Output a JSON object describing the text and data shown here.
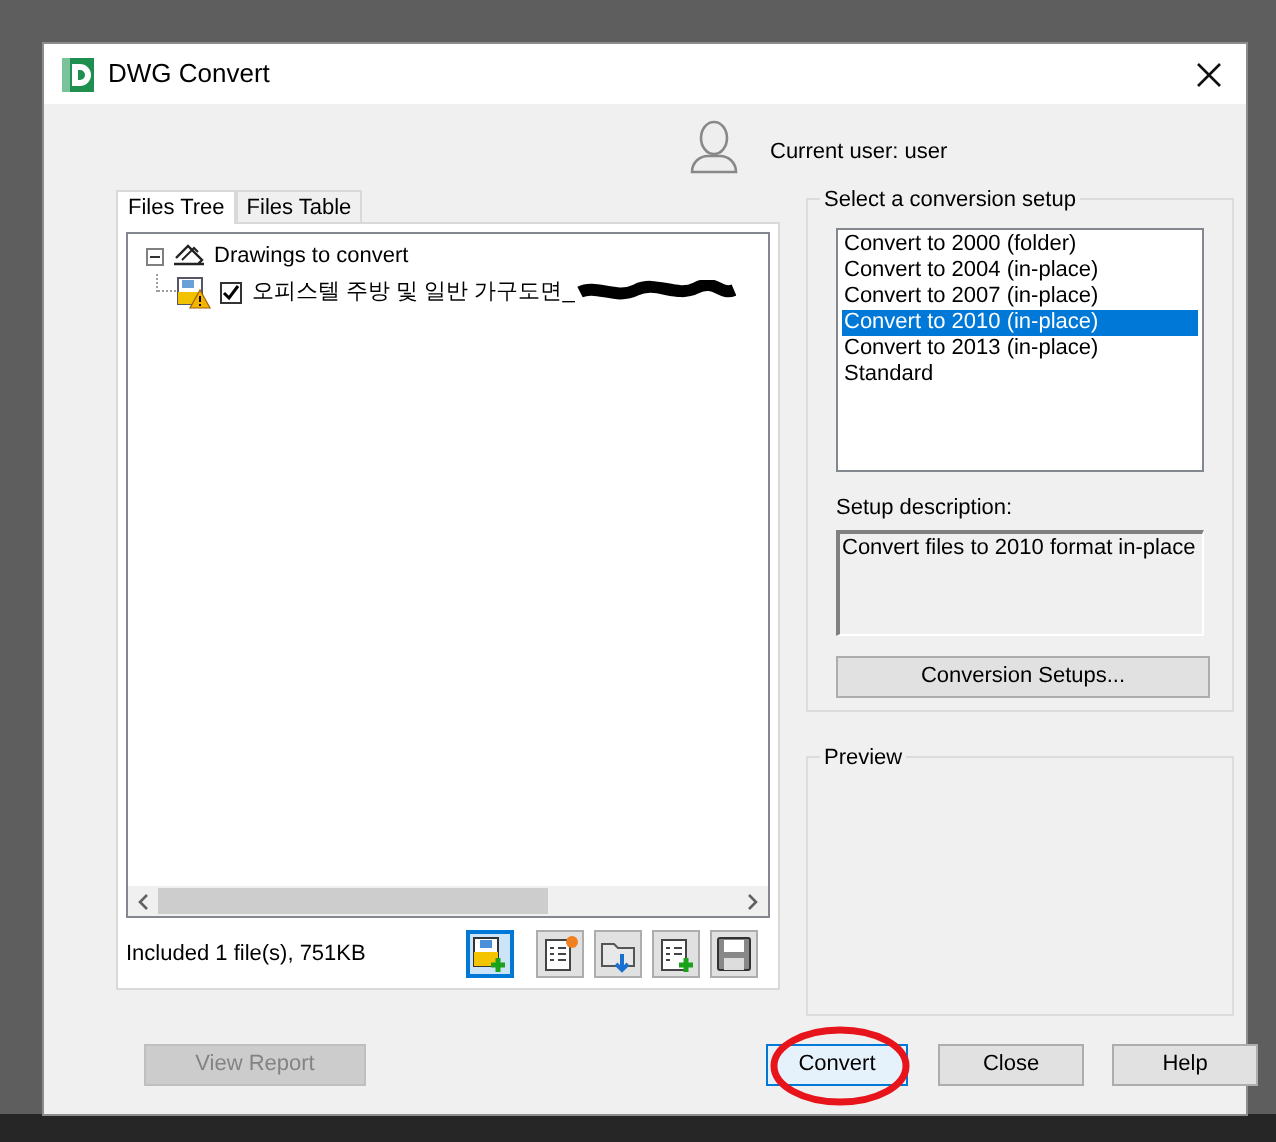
{
  "window": {
    "title": "DWG Convert"
  },
  "current_user": "Current user: user",
  "tabs": [
    {
      "label": "Files Tree",
      "selected": true
    },
    {
      "label": "Files Table",
      "selected": false
    }
  ],
  "tree": {
    "label": "Drawings to convert",
    "expanded": true,
    "children": [
      {
        "label": "오피스텔 주방 및 일반 가구도면_",
        "checked": true,
        "redacted": true
      }
    ]
  },
  "status": "Included 1 file(s), 751KB",
  "toolbar": [
    {
      "kind": "add-file",
      "selected": true
    },
    {
      "kind": "new-list",
      "selected": false
    },
    {
      "kind": "open-folder",
      "selected": false
    },
    {
      "kind": "append-list",
      "selected": false
    },
    {
      "kind": "save",
      "selected": false
    }
  ],
  "setup_group": {
    "title": "Select a conversion setup",
    "items": [
      {
        "label": "Convert to 2000 (folder)",
        "selected": false
      },
      {
        "label": "Convert to 2004 (in-place)",
        "selected": false
      },
      {
        "label": "Convert to 2007 (in-place)",
        "selected": false
      },
      {
        "label": "Convert to 2010 (in-place)",
        "selected": true
      },
      {
        "label": "Convert to 2013 (in-place)",
        "selected": false
      },
      {
        "label": "Standard",
        "selected": false
      }
    ],
    "description_label": "Setup description:",
    "description": "Convert files to 2010 format in-place",
    "button": "Conversion Setups..."
  },
  "preview": {
    "title": "Preview"
  },
  "buttons": [
    {
      "label": "View Report",
      "disabled": true,
      "default": false,
      "annotated": false
    },
    {
      "label": "Convert",
      "disabled": false,
      "default": true,
      "annotated": true
    },
    {
      "label": "Close",
      "disabled": false,
      "default": false,
      "annotated": false
    },
    {
      "label": "Help",
      "disabled": false,
      "default": false,
      "annotated": false
    }
  ]
}
